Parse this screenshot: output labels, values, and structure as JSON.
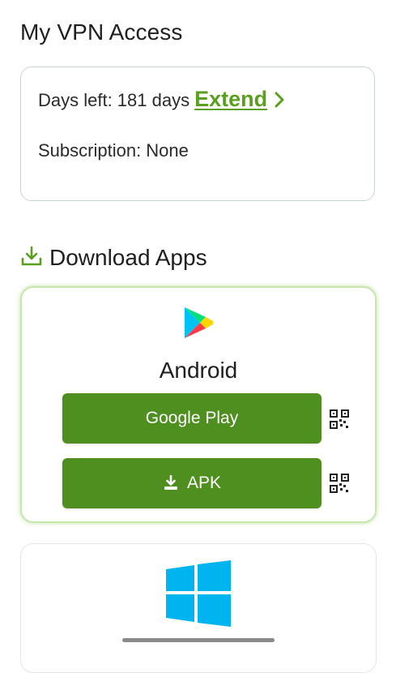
{
  "header": {
    "title": "My VPN Access"
  },
  "access": {
    "days_left_text": "Days left: 181 days",
    "extend_label": "Extend",
    "subscription_text": "Subscription: None"
  },
  "downloads": {
    "title": "Download Apps",
    "android": {
      "name": "Android",
      "google_play_label": "Google Play",
      "apk_label": "APK"
    }
  },
  "colors": {
    "accent_green": "#5aa01e",
    "button_green": "#4e8f1f",
    "windows_blue": "#00b4f0"
  },
  "icons": [
    "download-icon",
    "google-play-icon",
    "qr-code-icon",
    "windows-icon",
    "chevron-right-icon"
  ]
}
